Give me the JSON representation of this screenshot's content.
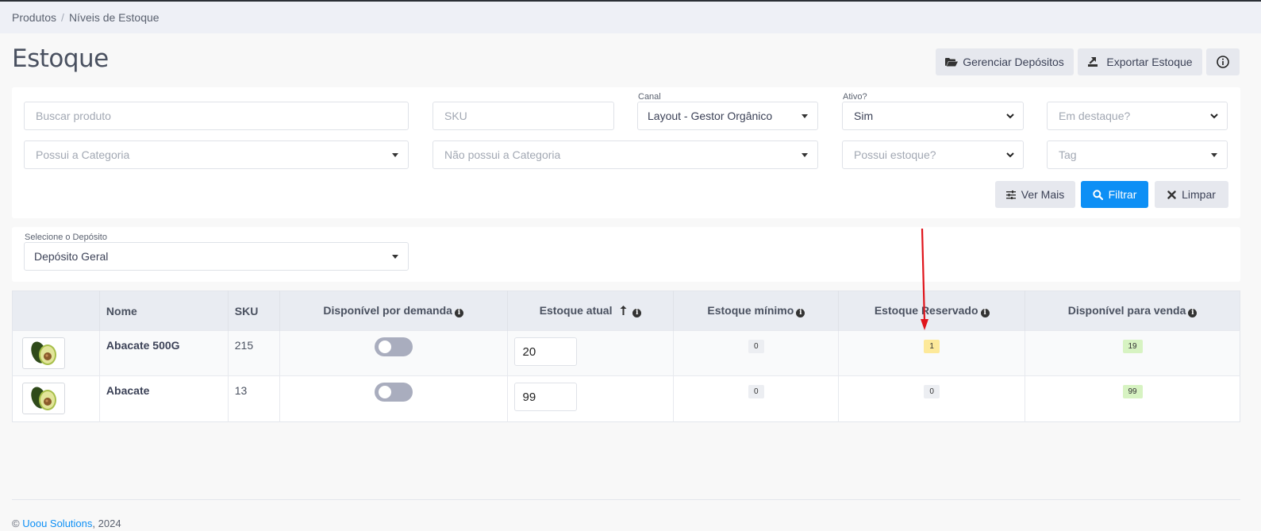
{
  "breadcrumb": {
    "items": [
      "Produtos",
      "Níveis de Estoque"
    ],
    "separator": "/"
  },
  "page_title": "Estoque",
  "header_buttons": {
    "manage_warehouses": "Gerenciar Depósitos",
    "export_stock": "Exportar Estoque"
  },
  "filters": {
    "search_placeholder": "Buscar produto",
    "sku_placeholder": "SKU",
    "channel_label": "Canal",
    "channel_value": "Layout - Gestor Orgânico",
    "active_label": "Ativo?",
    "active_value": "Sim",
    "featured_placeholder": "Em destaque?",
    "has_category_placeholder": "Possui a Categoria",
    "not_category_placeholder": "Não possui a Categoria",
    "has_stock_placeholder": "Possui estoque?",
    "tag_placeholder": "Tag",
    "more_button": "Ver Mais",
    "filter_button": "Filtrar",
    "clear_button": "Limpar"
  },
  "warehouse": {
    "label": "Selecione o Depósito",
    "value": "Depósito Geral"
  },
  "table": {
    "headers": [
      "Nome",
      "SKU",
      "Disponível por demanda",
      "Estoque atual",
      "Estoque mínimo",
      "Estoque Reservado",
      "Disponível para venda"
    ],
    "rows": [
      {
        "name": "Abacate 500G",
        "sku": "215",
        "on_demand": false,
        "current_stock": "20",
        "min_stock": "0",
        "reserved": "1",
        "available": "19"
      },
      {
        "name": "Abacate",
        "sku": "13",
        "on_demand": false,
        "current_stock": "99",
        "min_stock": "0",
        "reserved": "0",
        "available": "99"
      }
    ]
  },
  "footer": {
    "prefix": "©",
    "company": "Uoou Solutions",
    "year": "2024"
  },
  "colors": {
    "primary": "#0d8ff5",
    "annotation_arrow": "#e0141b",
    "reserved_badge": "#fde99a",
    "available_badge": "#d7f3c2"
  }
}
